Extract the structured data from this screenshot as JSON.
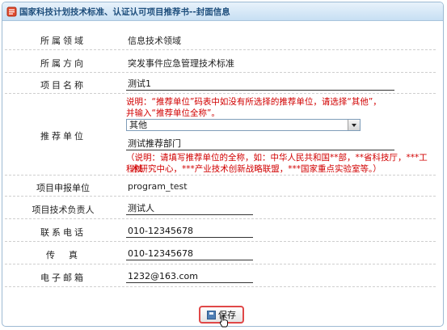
{
  "window": {
    "title": "国家科技计划技术标准、认证认可项目推荐书--封面信息"
  },
  "form": {
    "domain": {
      "label": "所属领域",
      "value": "信息技术领域"
    },
    "direction": {
      "label": "所属方向",
      "value": "突发事件应急管理技术标准"
    },
    "project_name": {
      "label": "项目名称",
      "value": "测试1"
    },
    "recommender": {
      "label": "推荐单位",
      "note_line1": "说明：“推荐单位”码表中如没有所选择的推荐单位，请选择“其他”，",
      "note_line2": "并输入“推荐单位全称”。",
      "select_value": "其他",
      "input_value": "测试推荐部门",
      "hint_line1": "（说明：请填写推荐单位的全称，如：中华人民共和国**部，**省科技厅，***工程技",
      "hint_line2": "术研究中心，***产业技术创新战略联盟，***国家重点实验室等。）"
    },
    "applicant_unit": {
      "label": "项目申报单位",
      "value": "program_test"
    },
    "tech_lead": {
      "label": "项目技术负责人",
      "value": "测试人"
    },
    "phone": {
      "label": "联系电话",
      "value": "010-12345678"
    },
    "fax": {
      "label": "传　真",
      "value": "010-12345678"
    },
    "email": {
      "label": "电子邮箱",
      "value": "1232@163.com"
    }
  },
  "actions": {
    "save_label": "保存"
  },
  "colors": {
    "title_text": "#1f4f7d",
    "note_red": "#d10000",
    "button_border": "#e04848"
  },
  "icons": {
    "title": "document-icon",
    "save": "save-icon",
    "cursor": "hand-cursor-icon"
  }
}
